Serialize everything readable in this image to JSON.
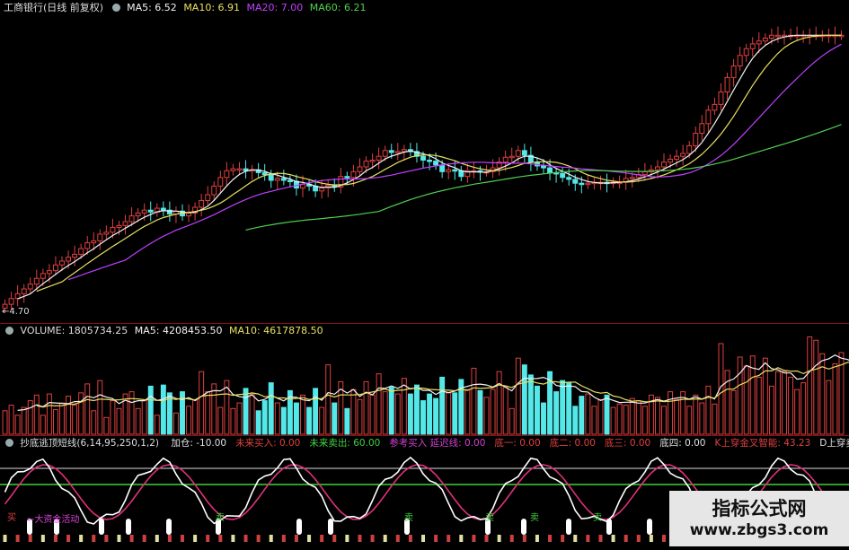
{
  "colors": {
    "up": "#e04040",
    "down": "#54e8e8",
    "ma5": "#f2f2f2",
    "ma10": "#e8e060",
    "ma20": "#c040ff",
    "ma60": "#50d050"
  },
  "price_panel": {
    "title": "工商银行(日线 前复权)",
    "ma5": "MA5: 6.52",
    "ma10": "MA10: 6.91",
    "ma20": "MA20: 7.00",
    "ma60": "MA60: 6.21",
    "low_label": "←4.70"
  },
  "volume_panel": {
    "volume": "VOLUME: 1805734.25",
    "ma5": "MA5: 4208453.50",
    "ma10": "MA10: 4617878.50"
  },
  "indicator_panel": {
    "name": "抄底逃顶短线(6,14,95,250,1,2)",
    "items": [
      {
        "text": "加仓: -10.00",
        "color": "#e0e0e0"
      },
      {
        "text": "未来买入: 0.00",
        "color": "#e04040"
      },
      {
        "text": "未来卖出: 60.00",
        "color": "#40d040"
      },
      {
        "text": "参考买入 延迟线: 0.00",
        "color": "#d040d0"
      },
      {
        "text": "底一: 0.00",
        "color": "#e04040"
      },
      {
        "text": "底二: 0.00",
        "color": "#e04040"
      },
      {
        "text": "底三: 0.00",
        "color": "#e04040"
      },
      {
        "text": "底四: 0.00",
        "color": "#e0e0e0"
      },
      {
        "text": "K上穿金叉智能: 43.23",
        "color": "#e04040"
      },
      {
        "text": "D上穿卖股",
        "color": "#e0e0e0"
      }
    ],
    "signal_label": "←大资金活动",
    "sell_label": "卖",
    "buy_label": "买"
  },
  "watermark": {
    "line1": "指标公式网",
    "line2": "www.zbgs3.com"
  },
  "chart_data": {
    "type": "candlestick",
    "title": "工商银行(日线 前复权)",
    "price_range": [
      4.6,
      7.7
    ],
    "low_marker": 4.7,
    "close": [
      4.72,
      4.78,
      4.83,
      4.88,
      4.93,
      4.99,
      5.04,
      5.07,
      5.13,
      5.17,
      5.21,
      5.24,
      5.3,
      5.36,
      5.38,
      5.45,
      5.47,
      5.52,
      5.54,
      5.58,
      5.64,
      5.67,
      5.7,
      5.68,
      5.72,
      5.7,
      5.66,
      5.69,
      5.64,
      5.67,
      5.73,
      5.8,
      5.86,
      5.95,
      6.04,
      6.11,
      6.13,
      6.13,
      6.11,
      6.12,
      6.09,
      6.07,
      6.01,
      6.03,
      6.01,
      6.0,
      5.93,
      5.97,
      5.95,
      5.9,
      5.93,
      5.96,
      5.94,
      6.05,
      6.04,
      6.1,
      6.15,
      6.21,
      6.22,
      6.26,
      6.32,
      6.3,
      6.31,
      6.33,
      6.31,
      6.26,
      6.22,
      6.21,
      6.17,
      6.1,
      6.12,
      6.11,
      6.05,
      6.11,
      6.11,
      6.1,
      6.1,
      6.14,
      6.2,
      6.25,
      6.26,
      6.32,
      6.27,
      6.2,
      6.16,
      6.14,
      6.09,
      6.08,
      6.04,
      6.02,
      5.98,
      5.97,
      5.98,
      5.99,
      5.99,
      5.98,
      5.99,
      5.99,
      6.03,
      6.04,
      6.07,
      6.1,
      6.12,
      6.15,
      6.2,
      6.23,
      6.26,
      6.29,
      6.37,
      6.5,
      6.6,
      6.74,
      6.8,
      6.93,
      7.08,
      7.2,
      7.31,
      7.38,
      7.43,
      7.46,
      7.49,
      7.52,
      7.52,
      7.52,
      7.52,
      7.52,
      7.52,
      7.52,
      7.52,
      7.52,
      7.52,
      7.52,
      7.52
    ],
    "volume_max": 8500000,
    "volume": [
      2100000,
      2600000,
      1700000,
      2400000,
      3000000,
      3500000,
      1700000,
      3600000,
      2200000,
      2800000,
      3400000,
      2600000,
      3700000,
      4500000,
      2100000,
      4800000,
      1500000,
      3000000,
      2300000,
      3600000,
      3800000,
      2300000,
      3000000,
      4300000,
      1700000,
      4400000,
      3700000,
      1900000,
      3800000,
      2500000,
      3100000,
      5600000,
      3800000,
      4500000,
      2400000,
      4800000,
      2300000,
      2800000,
      4100000,
      3600000,
      2100000,
      3000000,
      4600000,
      2800000,
      2400000,
      3900000,
      2800000,
      3500000,
      2400000,
      4100000,
      2400000,
      6200000,
      2800000,
      4700000,
      2300000,
      4000000,
      3100000,
      4700000,
      3500000,
      5400000,
      3800000,
      4200000,
      3600000,
      5000000,
      3600000,
      4400000,
      3000000,
      3600000,
      3200000,
      5100000,
      3700000,
      3700000,
      4900000,
      4000000,
      5900000,
      3900000,
      3300000,
      4000000,
      5600000,
      4200000,
      2300000,
      6800000,
      6200000,
      5300000,
      4300000,
      2800000,
      5600000,
      3800000,
      4800000,
      4600000,
      2500000,
      3400000,
      3600000,
      2500000,
      3100000,
      3500000,
      2400000,
      2700000,
      2600000,
      3200000,
      3000000,
      2500000,
      3500000,
      3300000,
      2500000,
      3800000,
      3100000,
      3800000,
      2500000,
      3500000,
      2800000,
      4300000,
      2700000,
      8100000,
      5700000,
      3900000,
      6900000,
      6100000,
      7000000,
      5100000,
      6800000,
      4300000,
      5600000,
      5600000,
      5100000,
      4000000,
      4600000,
      8700000,
      8400000,
      7200000,
      4800000,
      6300000,
      7300000,
      7800000,
      5700000
    ]
  }
}
